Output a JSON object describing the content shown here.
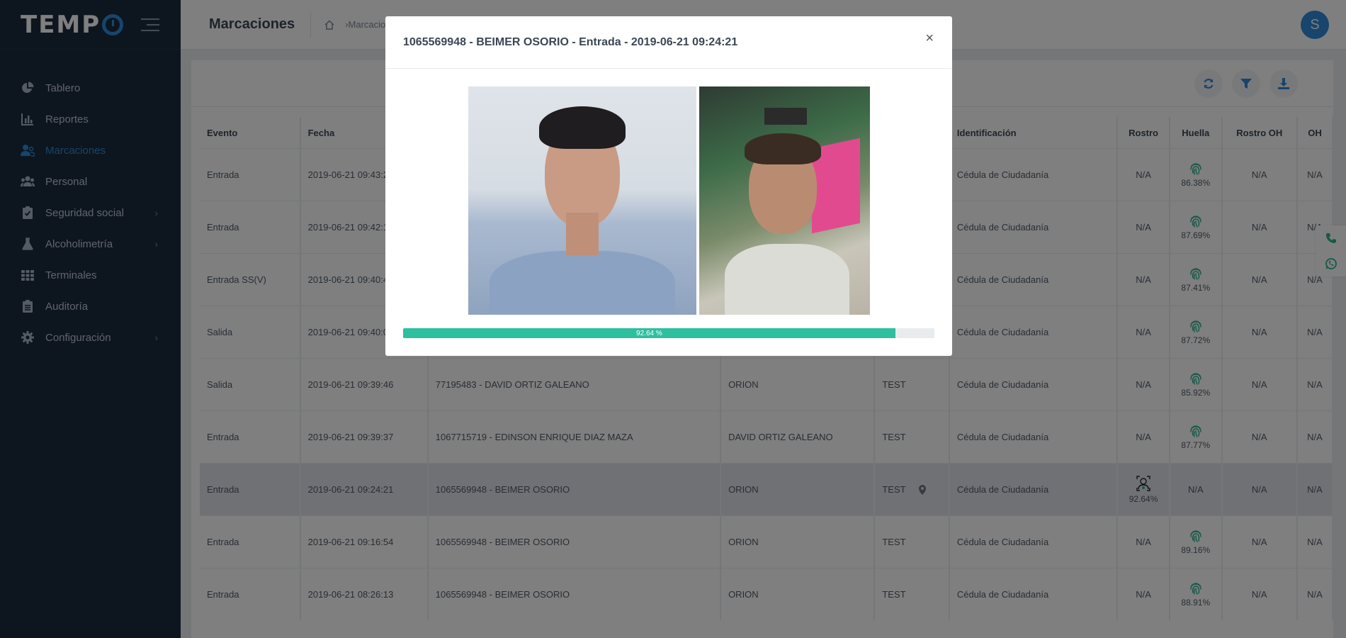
{
  "sidebar": {
    "logo": "TEMPO",
    "items": [
      {
        "label": "Tablero",
        "icon": "pie-chart-icon",
        "active": false
      },
      {
        "label": "Reportes",
        "icon": "bar-chart-icon",
        "active": false
      },
      {
        "label": "Marcaciones",
        "icon": "users-icon",
        "active": true
      },
      {
        "label": "Personal",
        "icon": "group-icon",
        "active": false
      },
      {
        "label": "Seguridad social",
        "icon": "clipboard-check-icon",
        "active": false,
        "has_children": true
      },
      {
        "label": "Alcoholimetría",
        "icon": "flask-icon",
        "active": false,
        "has_children": true
      },
      {
        "label": "Terminales",
        "icon": "grid-icon",
        "active": false
      },
      {
        "label": "Auditoría",
        "icon": "clipboard-list-icon",
        "active": false
      },
      {
        "label": "Configuración",
        "icon": "gear-icon",
        "active": false,
        "has_children": true
      }
    ]
  },
  "header": {
    "title": "Marcaciones",
    "breadcrumb": "Marcaciones",
    "avatar_initial": "S"
  },
  "table": {
    "columns": [
      "Evento",
      "Fecha",
      "",
      "",
      "",
      "Identificación",
      "Rostro",
      "Huella",
      "Rostro OH",
      "OH"
    ],
    "rows": [
      {
        "evento": "Entrada",
        "fecha": "2019-06-21 09:43:2",
        "persona": "",
        "terminal": "",
        "zona": "",
        "identificacion": "Cédula de Ciudadanía",
        "rostro": "N/A",
        "huella": "86.38%",
        "rostro_oh": "N/A",
        "oh": "N/A"
      },
      {
        "evento": "Entrada",
        "fecha": "2019-06-21 09:42:1",
        "persona": "",
        "terminal": "",
        "zona": "",
        "identificacion": "Cédula de Ciudadanía",
        "rostro": "N/A",
        "huella": "87.69%",
        "rostro_oh": "N/A",
        "oh": "N/A"
      },
      {
        "evento": "Entrada SS(V)",
        "fecha": "2019-06-21 09:40:4",
        "persona": "",
        "terminal": "",
        "zona": "",
        "identificacion": "Cédula de Ciudadanía",
        "rostro": "N/A",
        "huella": "87.41%",
        "rostro_oh": "N/A",
        "oh": "N/A"
      },
      {
        "evento": "Salida",
        "fecha": "2019-06-21 09:40:0",
        "persona": "",
        "terminal": "",
        "zona": "",
        "identificacion": "Cédula de Ciudadanía",
        "rostro": "N/A",
        "huella": "87.72%",
        "rostro_oh": "N/A",
        "oh": "N/A"
      },
      {
        "evento": "Salida",
        "fecha": "2019-06-21 09:39:46",
        "persona": "77195483 - DAVID ORTIZ GALEANO",
        "terminal": "ORION",
        "zona": "TEST",
        "identificacion": "Cédula de Ciudadanía",
        "rostro": "N/A",
        "huella": "85.92%",
        "rostro_oh": "N/A",
        "oh": "N/A"
      },
      {
        "evento": "Entrada",
        "fecha": "2019-06-21 09:39:37",
        "persona": "1067715719 - EDINSON ENRIQUE DIAZ MAZA",
        "terminal": "DAVID ORTIZ GALEANO",
        "zona": "TEST",
        "identificacion": "Cédula de Ciudadanía",
        "rostro": "N/A",
        "huella": "87.77%",
        "rostro_oh": "N/A",
        "oh": "N/A"
      },
      {
        "evento": "Entrada",
        "fecha": "2019-06-21 09:24:21",
        "persona": "1065569948 - BEIMER OSORIO",
        "terminal": "ORION",
        "zona": "TEST",
        "identificacion": "Cédula de Ciudadanía",
        "rostro": "92.64%",
        "huella": "N/A",
        "rostro_oh": "N/A",
        "oh": "N/A",
        "highlight": true
      },
      {
        "evento": "Entrada",
        "fecha": "2019-06-21 09:16:54",
        "persona": "1065569948 - BEIMER OSORIO",
        "terminal": "ORION",
        "zona": "TEST",
        "identificacion": "Cédula de Ciudadanía",
        "rostro": "N/A",
        "huella": "89.16%",
        "rostro_oh": "N/A",
        "oh": "N/A"
      },
      {
        "evento": "Entrada",
        "fecha": "2019-06-21 08:26:13",
        "persona": "1065569948 - BEIMER OSORIO",
        "terminal": "ORION",
        "zona": "TEST",
        "identificacion": "Cédula de Ciudadanía",
        "rostro": "N/A",
        "huella": "88.91%",
        "rostro_oh": "N/A",
        "oh": "N/A"
      }
    ]
  },
  "modal": {
    "title": "1065569948 - BEIMER OSORIO - Entrada - 2019-06-21 09:24:21",
    "close": "×",
    "match_label": "92.64 %",
    "match_value": 0.9264
  },
  "colors": {
    "sidebar_bg": "#1b2a3e",
    "accent": "#2e8ad8",
    "progress": "#2ebf9f"
  }
}
